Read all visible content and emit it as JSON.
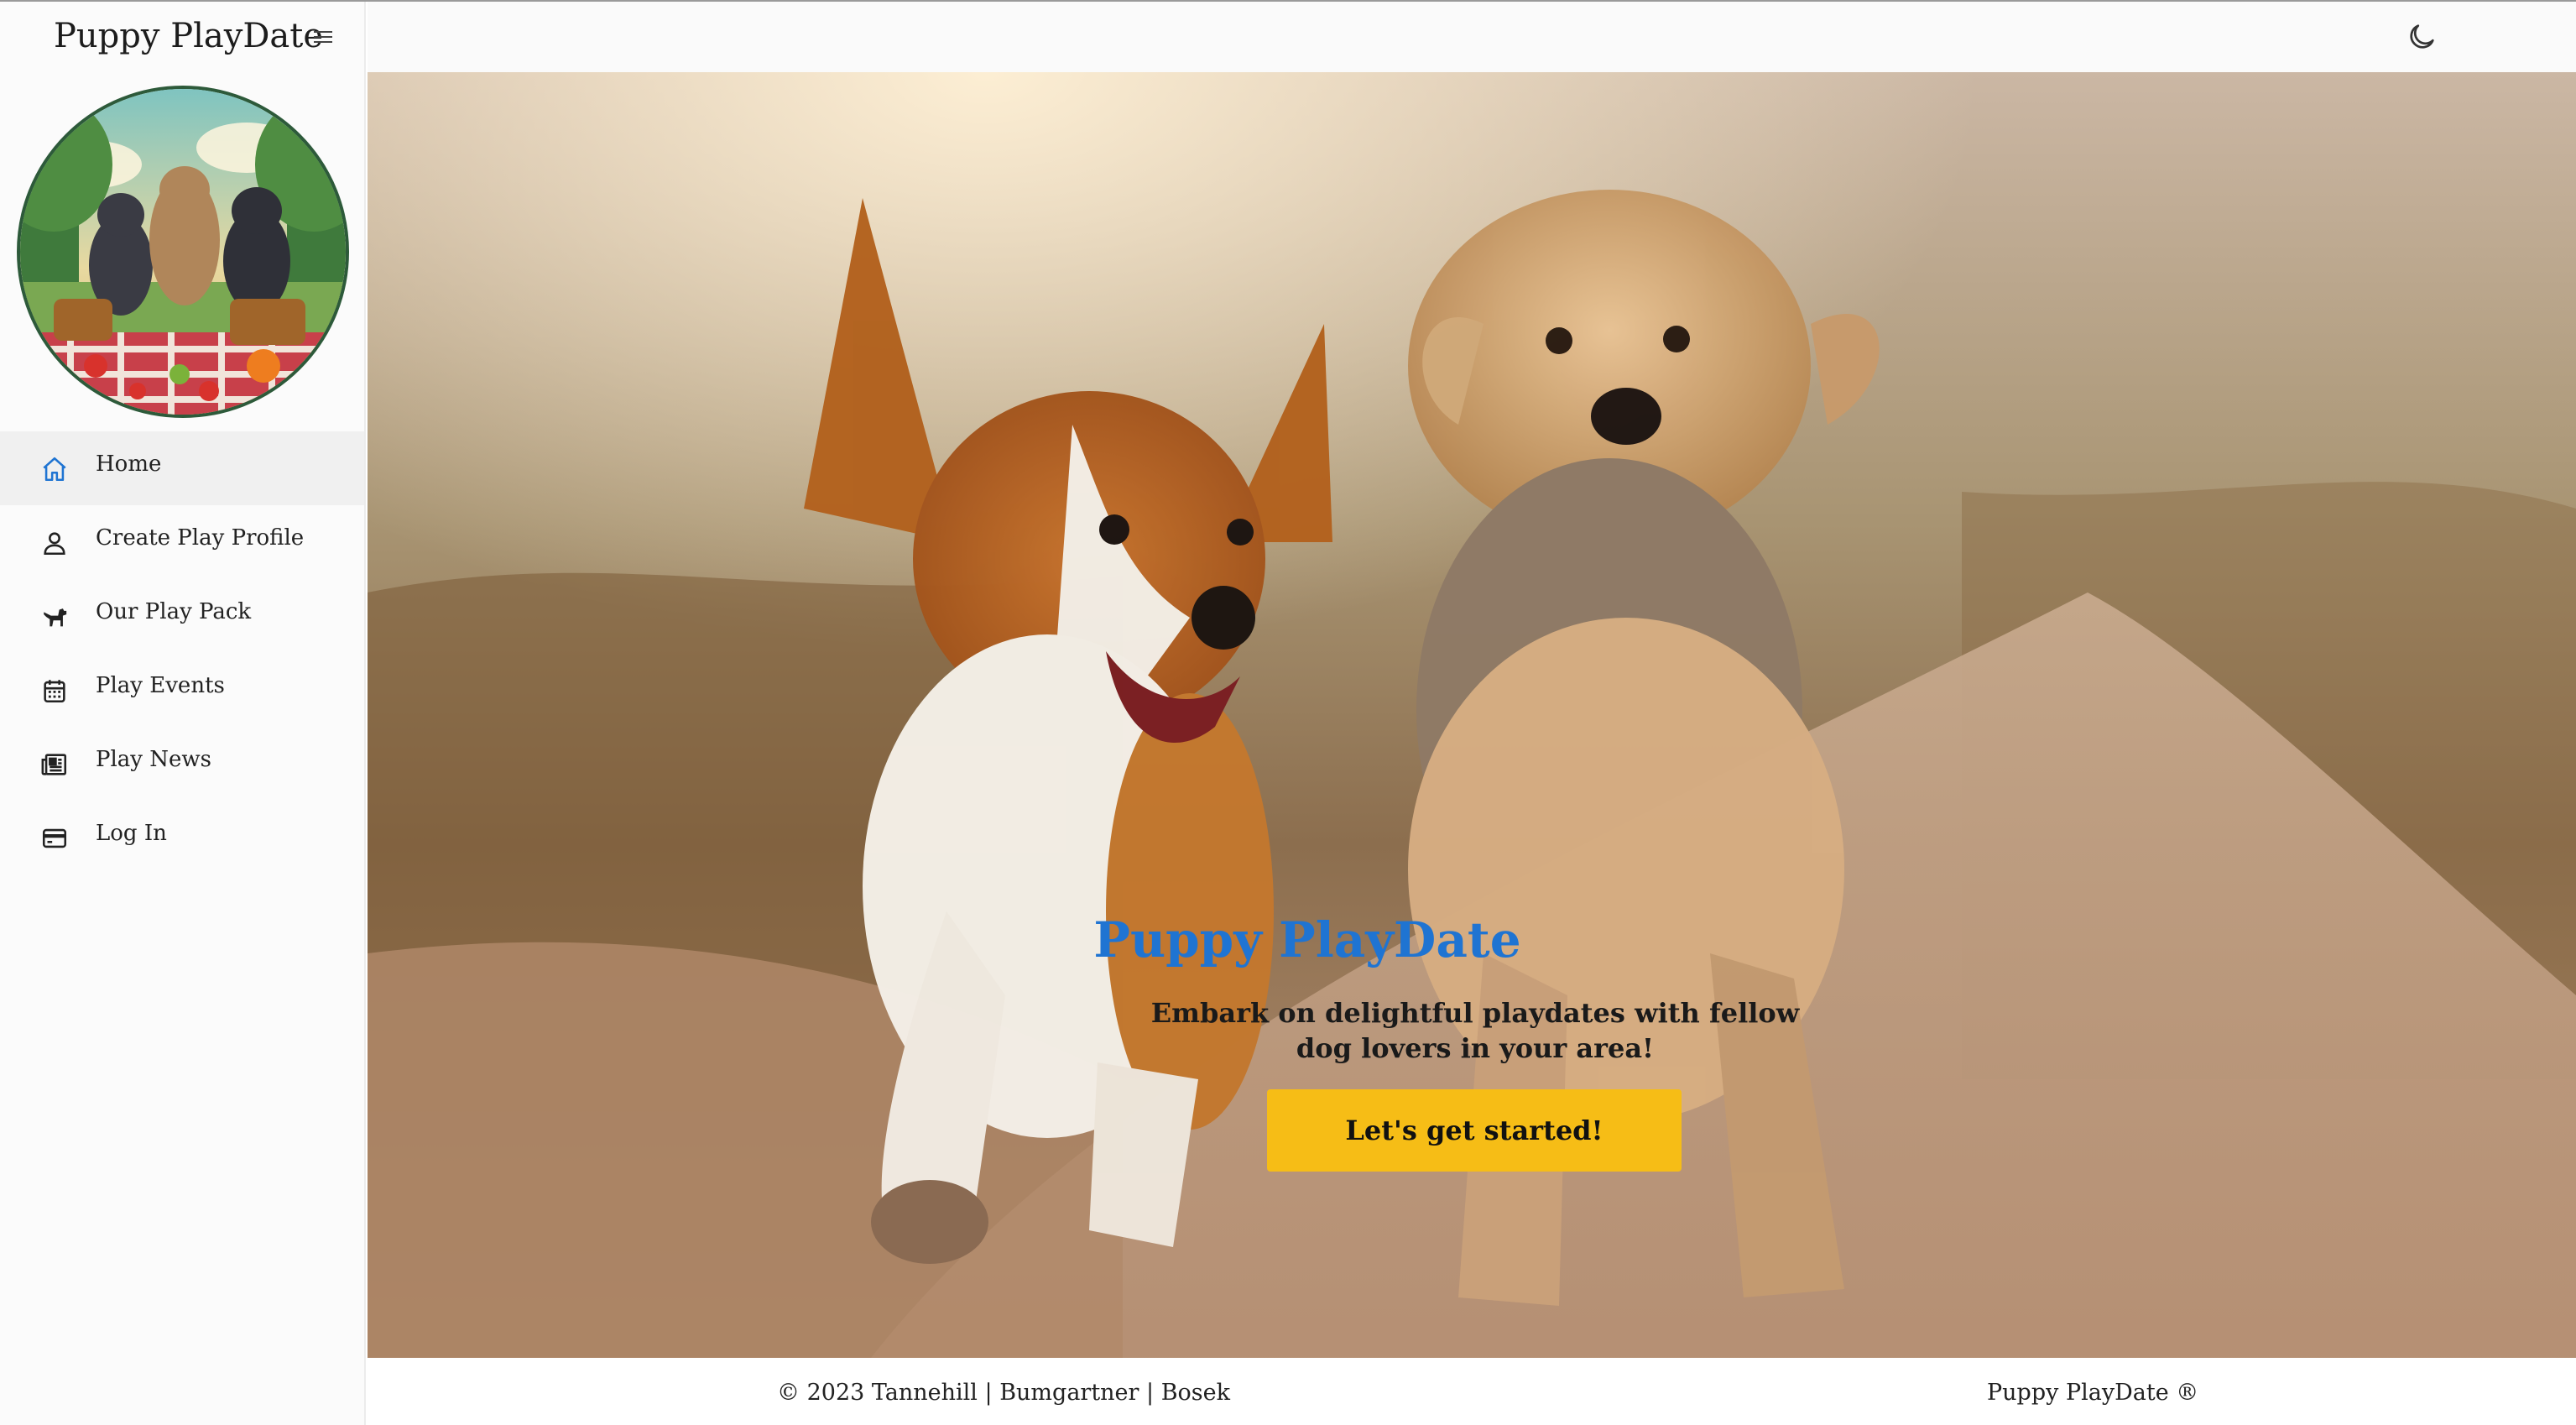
{
  "app": {
    "brand": "Puppy PlayDate"
  },
  "sidebar": {
    "items": [
      {
        "label": "Home",
        "icon": "home-icon",
        "active": true
      },
      {
        "label": "Create Play Profile",
        "icon": "user-icon",
        "active": false
      },
      {
        "label": "Our Play Pack",
        "icon": "dog-icon",
        "active": false
      },
      {
        "label": "Play Events",
        "icon": "calendar-icon",
        "active": false
      },
      {
        "label": "Play News",
        "icon": "newspaper-icon",
        "active": false
      },
      {
        "label": "Log In",
        "icon": "card-icon",
        "active": false
      }
    ]
  },
  "topbar": {
    "theme_icon": "moon-icon"
  },
  "hero": {
    "title": "Puppy PlayDate",
    "subtitle": "Embark on delightful playdates with fellow dog lovers in your area!",
    "cta": "Let's get started!"
  },
  "footer": {
    "copyright": "© 2023 Tannehill | Bumgartner | Bosek",
    "brand": "Puppy PlayDate ®"
  },
  "colors": {
    "accent": "#1f74d2",
    "cta": "#f6bd16",
    "active_nav_bg": "#f0f0f0"
  }
}
